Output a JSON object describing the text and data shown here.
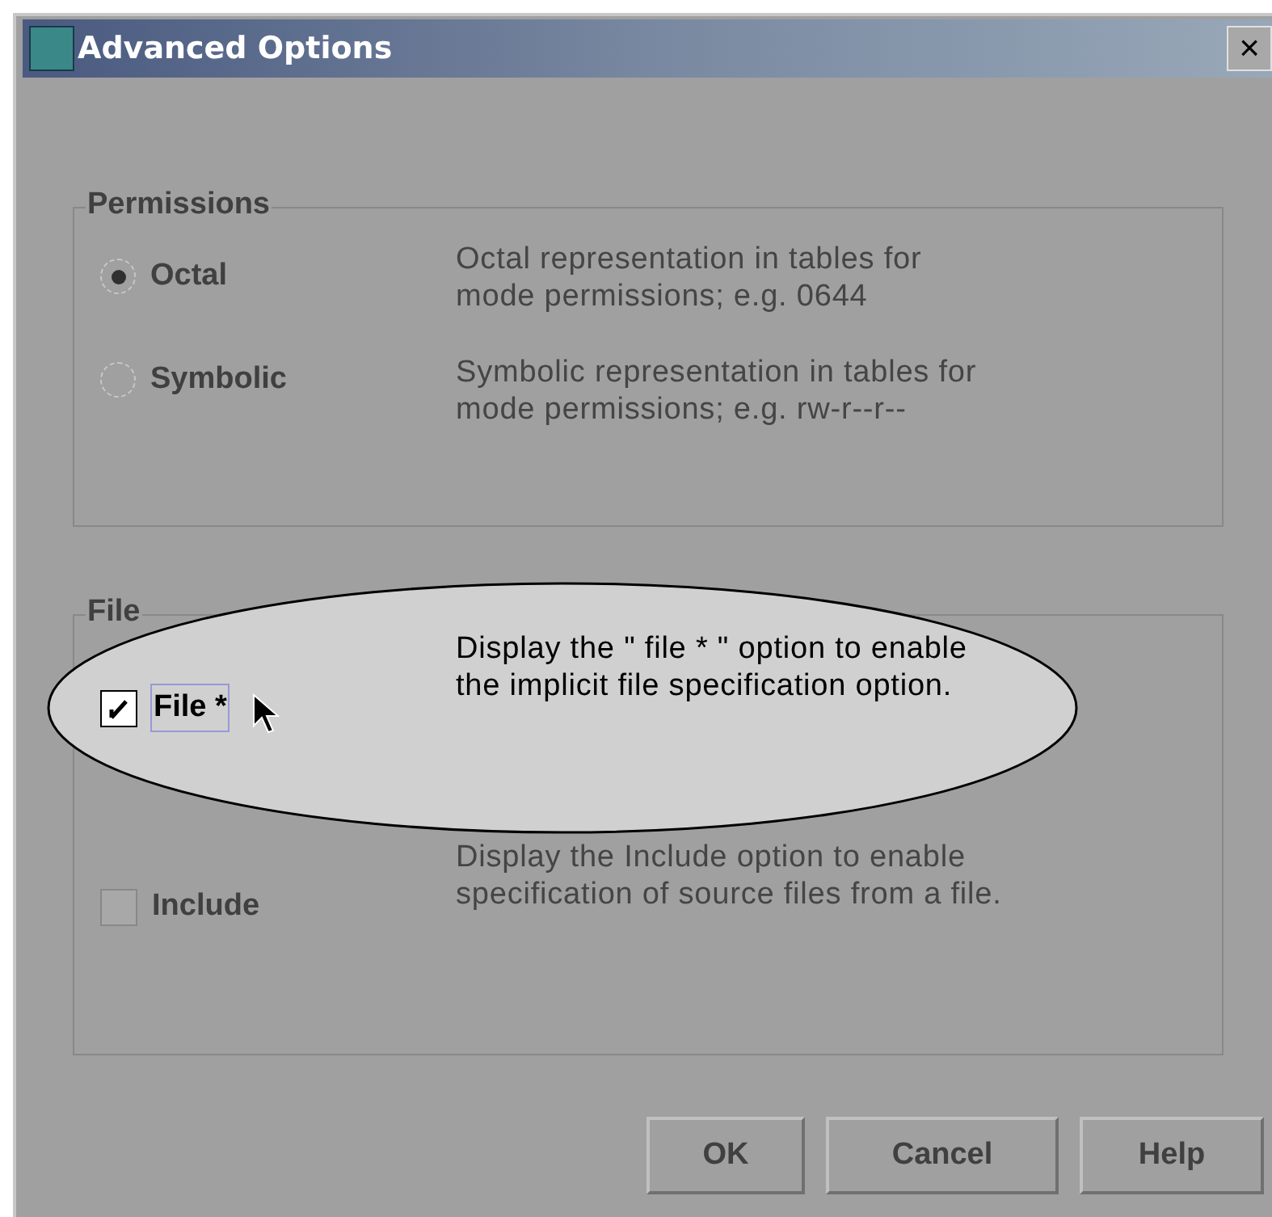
{
  "window": {
    "title": "Advanced Options",
    "close": "×"
  },
  "groups": [
    {
      "title": "Permissions",
      "items": [
        {
          "kind": "radio",
          "label": "Octal",
          "selected": true,
          "highlighted": false,
          "description": "Octal representation in tables for mode permissions; e.g. 0644"
        },
        {
          "kind": "radio",
          "label": "Symbolic",
          "selected": false,
          "highlighted": false,
          "description": "Symbolic representation in tables for mode permissions; e.g. rw-r--r--"
        }
      ]
    },
    {
      "title": "File",
      "items": [
        {
          "kind": "checkbox",
          "label": "File *",
          "checked": true,
          "highlighted": true,
          "description": "Display the \" file * \" option to enable the implicit file specification option."
        },
        {
          "kind": "checkbox",
          "label": "Include",
          "checked": false,
          "highlighted": false,
          "description": "Display the Include option to enable specification of source files from a file."
        }
      ]
    }
  ],
  "buttons": [
    "OK",
    "Cancel",
    "Help"
  ]
}
